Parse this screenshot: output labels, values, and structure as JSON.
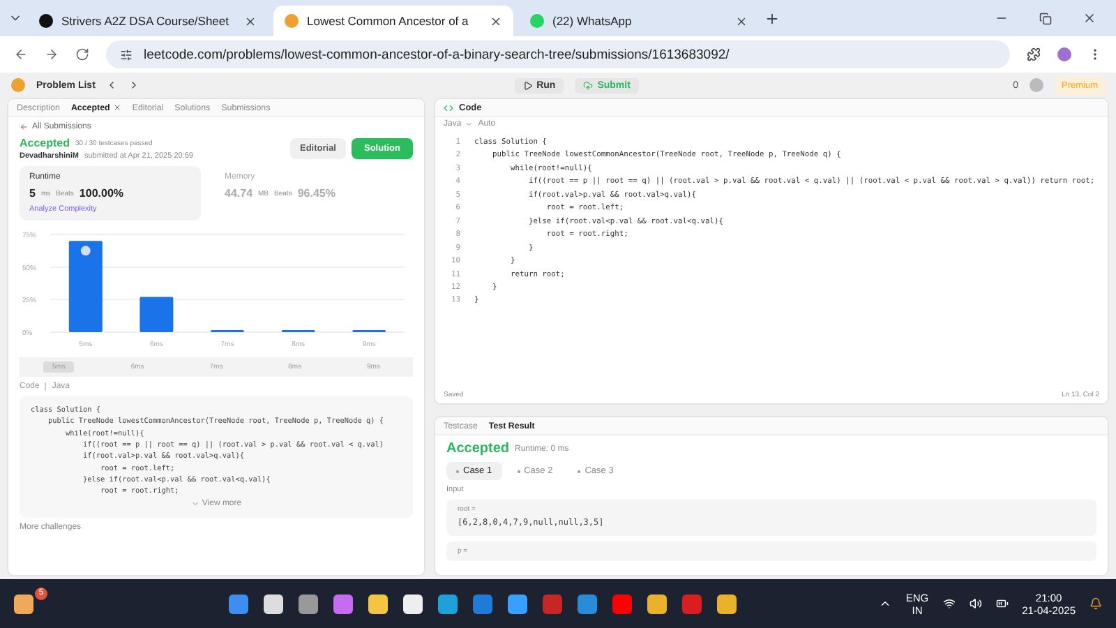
{
  "browser": {
    "tabs": [
      {
        "label": "Strivers A2Z DSA Course/Sheet",
        "selected": false
      },
      {
        "label": "Lowest Common Ancestor of a",
        "selected": true
      },
      {
        "label": "(22) WhatsApp",
        "selected": false
      }
    ],
    "url": "leetcode.com/problems/lowest-common-ancestor-of-a-binary-search-tree/submissions/1613683092/"
  },
  "header": {
    "problem_list": "Problem List",
    "run": "Run",
    "submit": "Submit",
    "streak": "0",
    "premium": "Premium"
  },
  "left_panel": {
    "tabs": [
      {
        "label": "Description",
        "selected": false,
        "closable": false
      },
      {
        "label": "Accepted",
        "selected": true,
        "closable": true
      },
      {
        "label": "Editorial",
        "selected": false,
        "closable": false
      },
      {
        "label": "Solutions",
        "selected": false,
        "closable": false
      },
      {
        "label": "Submissions",
        "selected": false,
        "closable": false
      }
    ],
    "back_link": "All Submissions",
    "status": "Accepted",
    "testcases": "30 / 30 testcases passed",
    "user": "DevadharshiniM",
    "submitted": "submitted at Apr 21, 2025 20:59",
    "editorial_button": "Editorial",
    "solution_button": "Solution",
    "runtime": {
      "title": "Runtime",
      "value": "5",
      "unit": "ms",
      "beats_label": "Beats",
      "beats": "100.00%",
      "analyze": "Analyze Complexity",
      "selected": true
    },
    "memory": {
      "title": "Memory",
      "value": "44.74",
      "unit": "MB",
      "beats_label": "Beats",
      "beats": "96.45%",
      "selected": false
    },
    "chart_data": {
      "type": "bar",
      "categories": [
        "5ms",
        "6ms",
        "7ms",
        "8ms",
        "9ms"
      ],
      "series": [
        {
          "color": "#1a73e8",
          "values": [
            70,
            27,
            1,
            1,
            1
          ]
        }
      ],
      "ylim": [
        0,
        75
      ],
      "yticks": [
        {
          "value": 0,
          "label": "0%"
        },
        {
          "value": 25,
          "label": "25%"
        },
        {
          "value": 50,
          "label": "50%"
        },
        {
          "value": 75,
          "label": "75%"
        }
      ]
    },
    "range_labels": [
      {
        "label": "5ms",
        "selected": true
      },
      {
        "label": "6ms",
        "selected": false
      },
      {
        "label": "7ms",
        "selected": false
      },
      {
        "label": "8ms",
        "selected": false
      },
      {
        "label": "9ms",
        "selected": false
      }
    ],
    "code_label": "Code",
    "language": "Java",
    "code_preview": [
      "class Solution {",
      "    public TreeNode lowestCommonAncestor(TreeNode root, TreeNode p, TreeNode q) {",
      "        while(root!=null){",
      "            if((root == p || root == q) || (root.val > p.val && root.val < q.val)",
      "            if(root.val>p.val && root.val>q.val){",
      "                root = root.left;",
      "            }else if(root.val<p.val && root.val<q.val){",
      "                root = root.right;"
    ],
    "view_more": "View more",
    "more_challenges": "More challenges"
  },
  "code_panel": {
    "title": "Code",
    "language": "Java",
    "mode": "Auto",
    "lines": [
      {
        "number": "1",
        "text": "class Solution {"
      },
      {
        "number": "2",
        "text": "    public TreeNode lowestCommonAncestor(TreeNode root, TreeNode p, TreeNode q) {"
      },
      {
        "number": "3",
        "text": "        while(root!=null){"
      },
      {
        "number": "4",
        "text": "            if((root == p || root == q) || (root.val > p.val && root.val < q.val) || (root.val < p.val && root.val > q.val)) return root;"
      },
      {
        "number": "5",
        "text": "            if(root.val>p.val && root.val>q.val){"
      },
      {
        "number": "6",
        "text": "                root = root.left;"
      },
      {
        "number": "7",
        "text": "            }else if(root.val<p.val && root.val<q.val){"
      },
      {
        "number": "8",
        "text": "                root = root.right;"
      },
      {
        "number": "9",
        "text": "            }"
      },
      {
        "number": "10",
        "text": "        }"
      },
      {
        "number": "11",
        "text": "        return root;"
      },
      {
        "number": "12",
        "text": "    }"
      },
      {
        "number": "13",
        "text": "}"
      }
    ],
    "saved": "Saved",
    "cursor": "Ln 13, Col 2"
  },
  "test_panel": {
    "tabs": [
      {
        "label": "Testcase",
        "selected": false
      },
      {
        "label": "Test Result",
        "selected": true
      }
    ],
    "status": "Accepted",
    "runtime": "Runtime: 0 ms",
    "cases": [
      {
        "label": "Case 1",
        "selected": true
      },
      {
        "label": "Case 2",
        "selected": false
      },
      {
        "label": "Case 3",
        "selected": false
      }
    ],
    "input_label": "Input",
    "inputs": [
      {
        "name": "root =",
        "value": "[6,2,8,0,4,7,9,null,null,3,5]"
      },
      {
        "name": "p ="
      }
    ]
  },
  "taskbar": {
    "weather_badge": "5",
    "language": "ENG",
    "region": "IN",
    "time": "21:00",
    "date": "21-04-2025"
  }
}
